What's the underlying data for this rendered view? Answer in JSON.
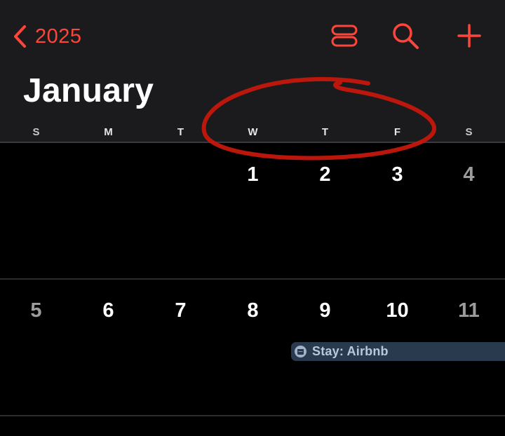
{
  "header": {
    "back_label": "2025",
    "month_title": "January"
  },
  "weekdays": [
    "S",
    "M",
    "T",
    "W",
    "T",
    "F",
    "S"
  ],
  "weeks": [
    [
      "",
      "",
      "",
      "1",
      "2",
      "3",
      "4"
    ],
    [
      "5",
      "6",
      "7",
      "8",
      "9",
      "10",
      "11"
    ]
  ],
  "event": {
    "label": "Stay: Airbnb"
  },
  "icons": {
    "back": "chevron-left-icon",
    "view_toggle": "list-view-icon",
    "search": "search-icon",
    "add": "plus-icon",
    "event": "calendar-icon"
  },
  "colors": {
    "accent": "#ff453a",
    "annotation": "#c4170c",
    "event_bg": "#2a3a4e",
    "event_text": "#b7c8dc"
  }
}
